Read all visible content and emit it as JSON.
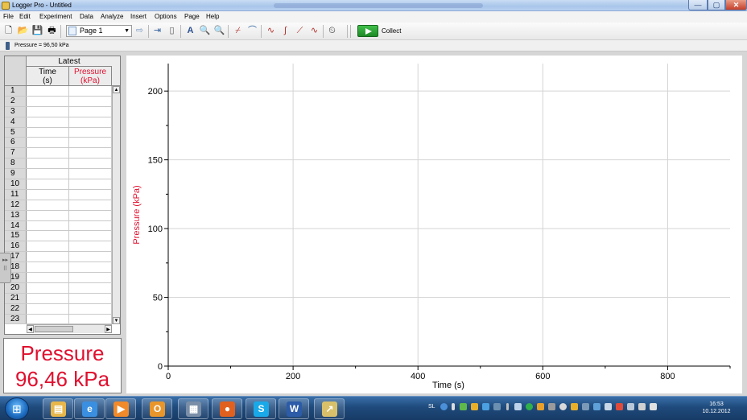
{
  "window": {
    "title": "Logger Pro - Untitled",
    "min_label": "—",
    "max_label": "▢",
    "close_label": "✕"
  },
  "menu": [
    "File",
    "Edit",
    "Experiment",
    "Data",
    "Analyze",
    "Insert",
    "Options",
    "Page",
    "Help"
  ],
  "toolbar": {
    "page_select": "Page 1",
    "collect_label": "Collect"
  },
  "status": {
    "sensor_reading": "Pressure = 96,50 kPa"
  },
  "table": {
    "set_name": "Latest",
    "columns": [
      {
        "name": "Time",
        "unit": "(s)",
        "color": "#000000"
      },
      {
        "name": "Pressure",
        "unit": "(kPa)",
        "color": "#e0102f"
      }
    ],
    "row_numbers": [
      "1",
      "2",
      "3",
      "4",
      "5",
      "6",
      "7",
      "8",
      "9",
      "10",
      "11",
      "12",
      "13",
      "14",
      "15",
      "16",
      "17",
      "18",
      "19",
      "20",
      "21",
      "22",
      "23"
    ]
  },
  "meter": {
    "label": "Pressure",
    "value": "96,46 kPa",
    "color": "#e0102f"
  },
  "chart_data": {
    "type": "line",
    "title": "",
    "xlabel": "Time (s)",
    "ylabel": "Pressure (kPa)",
    "xlim": [
      0,
      900
    ],
    "ylim": [
      0,
      220
    ],
    "x_ticks": [
      0,
      200,
      400,
      600,
      800
    ],
    "y_ticks": [
      0,
      50,
      100,
      150,
      200
    ],
    "grid": true,
    "series": [],
    "ylabel_color": "#e0102f"
  },
  "taskbar": {
    "apps": [
      {
        "name": "windows-explorer",
        "glyph": "▤",
        "color": "#e8b74a"
      },
      {
        "name": "internet-explorer",
        "glyph": "e",
        "color": "#3b8fe0"
      },
      {
        "name": "media-player",
        "glyph": "▶",
        "color": "#f08a2a"
      },
      {
        "name": "outlook",
        "glyph": "O",
        "color": "#e8952a"
      },
      {
        "name": "calculator",
        "glyph": "▦",
        "color": "#7a8ea8"
      },
      {
        "name": "firefox",
        "glyph": "●",
        "color": "#e0611f"
      },
      {
        "name": "skype",
        "glyph": "S",
        "color": "#19a9e8"
      },
      {
        "name": "word",
        "glyph": "W",
        "color": "#2c5ba8"
      },
      {
        "name": "logger-pro",
        "glyph": "↗",
        "color": "#d8c06a"
      }
    ],
    "tray_language": "SL",
    "clock_time": "16:53",
    "clock_date": "10.12.2012"
  }
}
